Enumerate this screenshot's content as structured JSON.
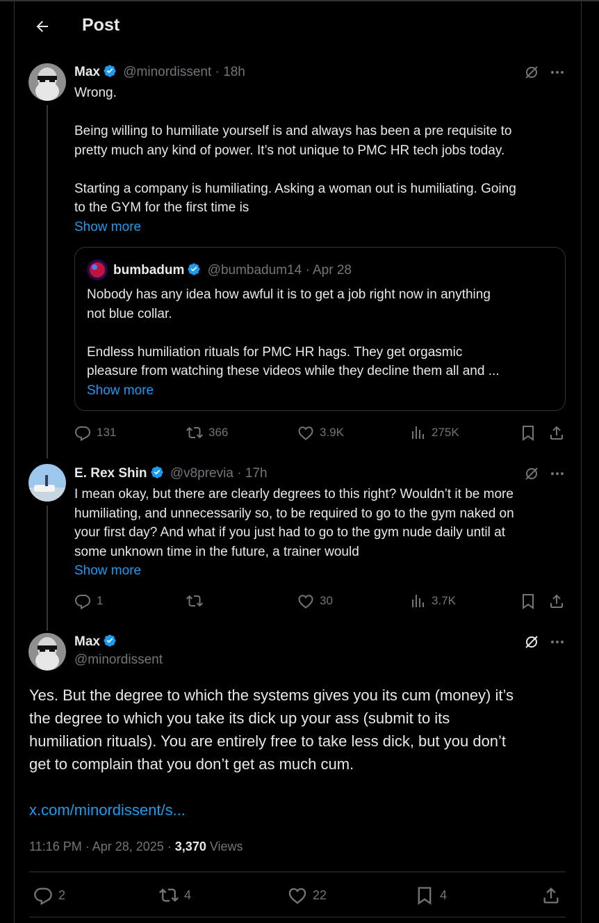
{
  "header": {
    "title": "Post"
  },
  "tweet1": {
    "name": "Max",
    "handle": "@minordissent",
    "sep": "·",
    "time": "18h",
    "lines": [
      "Wrong.",
      "",
      "Being willing to humiliate yourself is and always has been a pre requisite to",
      "pretty much any kind of power. It’s not unique to PMC HR tech jobs today.",
      "",
      "Starting a company is humiliating. Asking a woman out is humiliating. Going",
      "to the GYM for the first time is"
    ],
    "show_more": "Show more",
    "quote": {
      "name": "bumbadum",
      "handle": "@bumbadum14",
      "sep": "·",
      "date": "Apr 28",
      "lines": [
        "Nobody has any idea how awful it is to get a job right now in anything",
        "not blue collar.",
        "",
        "Endless humiliation rituals for PMC HR hags. They get orgasmic",
        "pleasure from watching these videos while they decline them all and ..."
      ],
      "show_more": "Show more"
    },
    "stats": {
      "replies": "131",
      "reposts": "366",
      "likes": "3.9K",
      "views": "275K"
    }
  },
  "tweet2": {
    "name": "E. Rex Shin",
    "handle": "@v8previa",
    "sep": "·",
    "time": "17h",
    "lines": [
      "I mean okay, but there are clearly degrees to this right? Wouldn’t it be more",
      "humiliating, and unnecessarily so, to be required to go to the gym naked on",
      "your first day? And what if you just had to go to the gym nude daily until at",
      "some unknown time in the future, a trainer would"
    ],
    "show_more": "Show more",
    "stats": {
      "replies": "1",
      "reposts": "",
      "likes": "30",
      "views": "3.7K"
    }
  },
  "main": {
    "name": "Max",
    "handle": "@minordissent",
    "lines": [
      "Yes. But the degree to which the systems gives you its cum (money) it’s",
      "the degree to which you take its dick up your ass (submit to its",
      "humiliation rituals). You are entirely free to take less dick, but you don’t",
      "get to complain that you don’t get as much cum."
    ],
    "link": "x.com/minordissent/s...",
    "timestamp": "11:16 PM · Apr 28, 2025 · ",
    "views_count": "3,370",
    "views_label": " Views",
    "stats": {
      "replies": "2",
      "reposts": "4",
      "likes": "22",
      "bookmarks": "4"
    }
  },
  "colors": {
    "accent": "#1d9bf0",
    "text": "#e7e9ea",
    "muted": "#71767b",
    "border": "#2f3336"
  },
  "icons": [
    "back-arrow-icon",
    "verified-icon",
    "grok-icon",
    "more-icon",
    "reply-icon",
    "repost-icon",
    "like-icon",
    "views-icon",
    "bookmark-icon",
    "share-icon"
  ]
}
